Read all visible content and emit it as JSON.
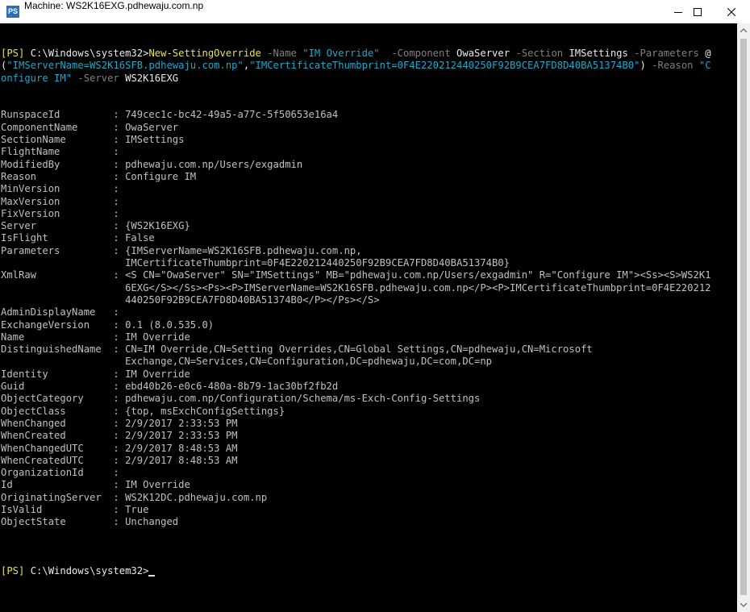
{
  "window": {
    "title": "Machine: WS2K16EXG.pdhewaju.com.np",
    "icon_text": "PS"
  },
  "command": {
    "prompt": "[PS]",
    "path": " C:\\Windows\\system32>",
    "cmdlet": "New-SettingOverride",
    "p_name": " -Name ",
    "v_name": "\"IM Override\"",
    "p_component": "  -Component ",
    "v_component": "OwaServer",
    "p_section": " -Section ",
    "v_section": "IMSettings",
    "p_parameters": " -Parameters ",
    "at": "@",
    "line2_open": "(",
    "v_param1": "\"IMServerName=WS2K16SFB.pdhewaju.com.np\"",
    "comma": ",",
    "v_param2": "\"IMCertificateThumbprint=0F4E220212440250F92B9CEA7FD8D40BA51374B0\"",
    "line2_close": ")",
    "p_reason": " -Reason ",
    "v_reason_a": "\"C",
    "v_reason_b": "onfigure IM\"",
    "p_server": " -Server ",
    "v_server": "WS2K16EXG"
  },
  "output": [
    "",
    "",
    "RunspaceId         : 749cec1c-bc42-49a5-a77c-5f50653e16a4",
    "ComponentName      : OwaServer",
    "SectionName        : IMSettings",
    "FlightName         :",
    "ModifiedBy         : pdhewaju.com.np/Users/exgadmin",
    "Reason             : Configure IM",
    "MinVersion         :",
    "MaxVersion         :",
    "FixVersion         :",
    "Server             : {WS2K16EXG}",
    "IsFlight           : False",
    "Parameters         : {IMServerName=WS2K16SFB.pdhewaju.com.np,",
    "                     IMCertificateThumbprint=0F4E220212440250F92B9CEA7FD8D40BA51374B0}",
    "XmlRaw             : <S CN=\"OwaServer\" SN=\"IMSettings\" MB=\"pdhewaju.com.np/Users/exgadmin\" R=\"Configure IM\"><Ss><S>WS2K1",
    "                     6EXG</S></Ss><Ps><P>IMServerName=WS2K16SFB.pdhewaju.com.np</P><P>IMCertificateThumbprint=0F4E220212",
    "                     440250F92B9CEA7FD8D40BA51374B0</P></Ps></S>",
    "AdminDisplayName   :",
    "ExchangeVersion    : 0.1 (8.0.535.0)",
    "Name               : IM Override",
    "DistinguishedName  : CN=IM Override,CN=Setting Overrides,CN=Global Settings,CN=pdhewaju,CN=Microsoft",
    "                     Exchange,CN=Services,CN=Configuration,DC=pdhewaju,DC=com,DC=np",
    "Identity           : IM Override",
    "Guid               : ebd40b26-e0c6-480a-8b79-1ac30bf2fb2d",
    "ObjectCategory     : pdhewaju.com.np/Configuration/Schema/ms-Exch-Config-Settings",
    "ObjectClass        : {top, msExchConfigSettings}",
    "WhenChanged        : 2/9/2017 2:33:53 PM",
    "WhenCreated        : 2/9/2017 2:33:53 PM",
    "WhenChangedUTC     : 2/9/2017 8:48:53 AM",
    "WhenCreatedUTC     : 2/9/2017 8:48:53 AM",
    "OrganizationId     :",
    "Id                 : IM Override",
    "OriginatingServer  : WS2K12DC.pdhewaju.com.np",
    "IsValid            : True",
    "ObjectState        : Unchanged",
    "",
    "",
    ""
  ],
  "final_prompt": {
    "prompt": "[PS]",
    "path": " C:\\Windows\\system32>"
  },
  "icons": {
    "minimize": "minimize-icon",
    "maximize": "maximize-icon",
    "close": "close-icon",
    "scroll_up": "scroll-up-icon",
    "scroll_down": "scroll-down-icon"
  }
}
